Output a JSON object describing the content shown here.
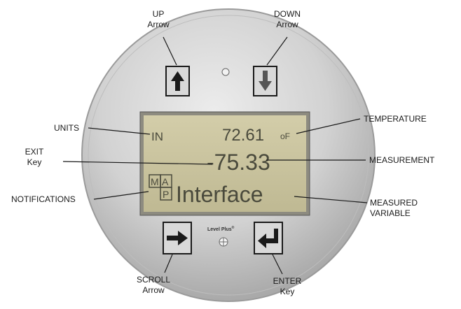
{
  "display": {
    "units": "IN",
    "temperature_value": "72.61",
    "temperature_unit": "oF",
    "measurement_value": "-75.33",
    "measured_variable": "Interface",
    "notification_letters": [
      "M",
      "A",
      "P"
    ]
  },
  "device": {
    "brand": "Level Plus",
    "brand_mark": "®"
  },
  "labels": {
    "up_arrow": [
      "UP",
      "Arrow"
    ],
    "down_arrow": [
      "DOWN",
      "Arrow"
    ],
    "units": "UNITS",
    "exit_key": [
      "EXIT",
      "Key"
    ],
    "notifications": "NOTIFICATIONS",
    "temperature": "TEMPERATURE",
    "measurement": "MEASUREMENT",
    "measured_variable": [
      "MEASURED",
      "VARIABLE"
    ],
    "scroll_arrow": [
      "SCROLL",
      "Arrow"
    ],
    "enter_key": [
      "ENTER",
      "Key"
    ]
  },
  "colors": {
    "lcd_background": "#c9c3a0",
    "lcd_text": "#4a4a3c",
    "bezel": "#c8c8c8",
    "key_frame": "#1a1a1a"
  },
  "icons": {
    "up": "arrow-up-icon",
    "down": "arrow-down-icon",
    "scroll": "arrow-right-icon",
    "enter": "enter-return-icon"
  }
}
